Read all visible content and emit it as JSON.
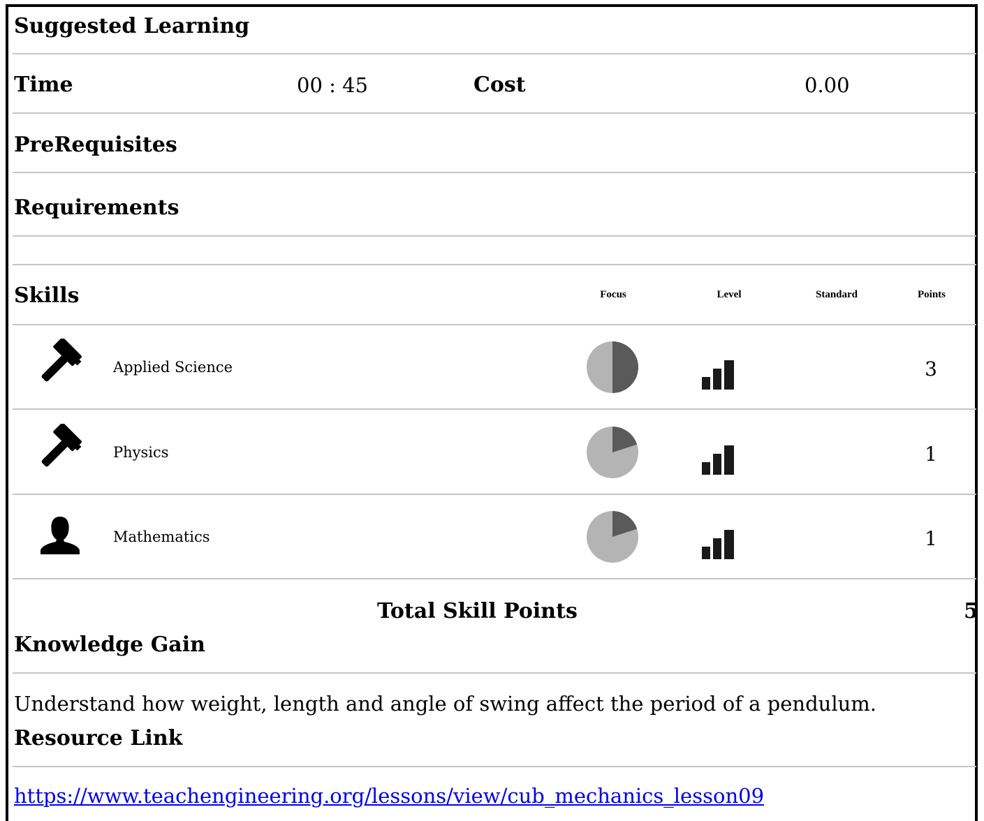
{
  "section_title": "Suggested Learning",
  "time": {
    "label": "Time",
    "value": "00 : 45"
  },
  "cost": {
    "label": "Cost",
    "value": "0.00"
  },
  "prerequisites_label": "PreRequisites",
  "requirements_label": "Requirements",
  "skills": {
    "label": "Skills",
    "columns": {
      "focus": "Focus",
      "level": "Level",
      "standard": "Standard",
      "points": "Points"
    },
    "rows": [
      {
        "icon": "hammer-icon",
        "name": "Applied Science",
        "focus_fraction": 0.5,
        "level_bars": 3,
        "points": "3"
      },
      {
        "icon": "hammer-icon",
        "name": "Physics",
        "focus_fraction": 0.2,
        "level_bars": 3,
        "points": "1"
      },
      {
        "icon": "user-icon",
        "name": "Mathematics",
        "focus_fraction": 0.2,
        "level_bars": 3,
        "points": "1"
      }
    ],
    "total_label": "Total Skill Points",
    "total_value": "5"
  },
  "knowledge": {
    "label": "Knowledge Gain",
    "text": "Understand how weight, length and angle of swing affect the period of a pendulum."
  },
  "resource": {
    "label": "Resource Link",
    "url": "https://www.teachengineering.org/lessons/view/cub_mechanics_lesson09"
  },
  "colors": {
    "pie_dark": "#5a5a5a",
    "pie_light": "#b4b4b4",
    "bars": "#1a1a1a",
    "divider": "#c6c6c6",
    "link": "#0000ee"
  }
}
